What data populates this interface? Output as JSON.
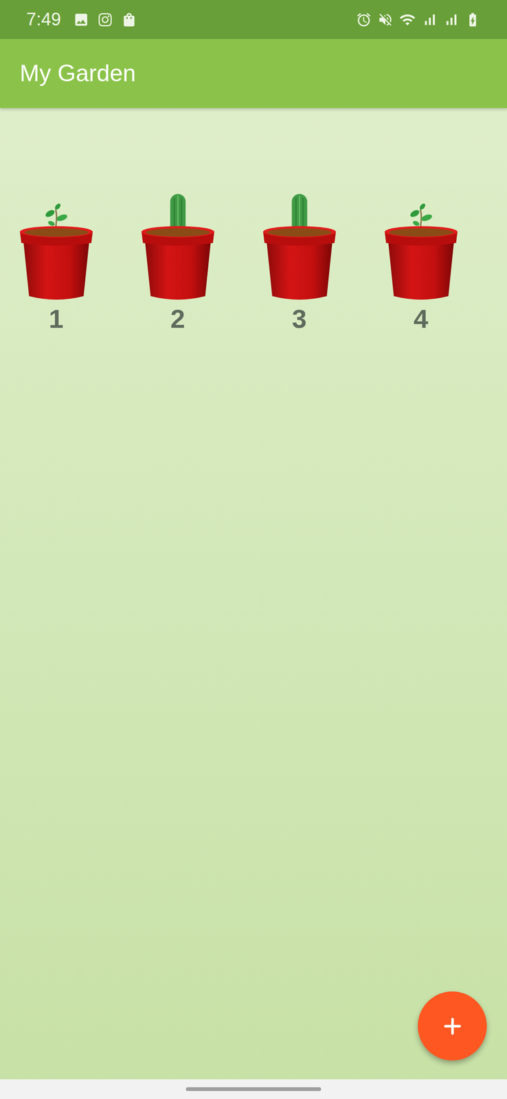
{
  "status_bar": {
    "time": "7:49"
  },
  "app_bar": {
    "title": "My Garden"
  },
  "plants": [
    {
      "label": "1",
      "kind": "sprout"
    },
    {
      "label": "2",
      "kind": "cactus"
    },
    {
      "label": "3",
      "kind": "cactus"
    },
    {
      "label": "4",
      "kind": "sprout"
    }
  ]
}
